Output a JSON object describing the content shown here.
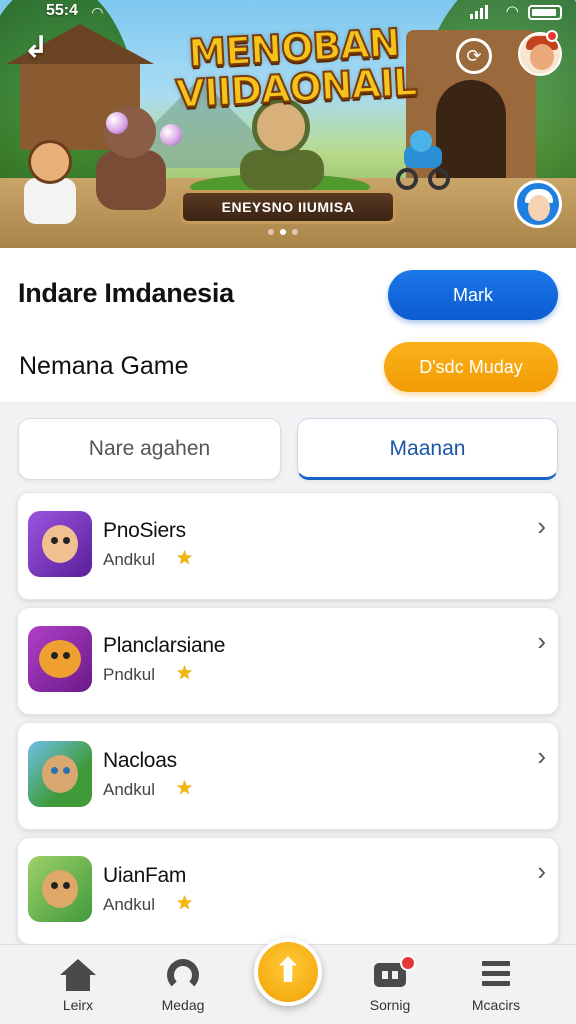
{
  "status_bar": {
    "time": "55:4"
  },
  "hero": {
    "title_line1": "MENOBAN",
    "title_line2": "VIIDAONAIL",
    "plaque": "ENEYSNO IIUMISA",
    "slide_count": 3,
    "active_slide": 2
  },
  "header": {
    "title": "Indare Imdanesia",
    "subtitle": "Nemana Game",
    "primary_button": "Mark",
    "secondary_button": "D'sdc Muday"
  },
  "tabs": [
    {
      "label": "Nare agahen",
      "active": false
    },
    {
      "label": "Maanan",
      "active": true
    }
  ],
  "games": [
    {
      "name": "PnoSiers",
      "developer": "Andkul",
      "icon": "purple-hair-character-icon",
      "icon_bg": "#7b3fbf"
    },
    {
      "name": "Planclarsiane",
      "developer": "Pndkul",
      "icon": "orange-face-character-icon",
      "icon_bg": "#8a2a9a"
    },
    {
      "name": "Nacloas",
      "developer": "Andkul",
      "icon": "goggles-warrior-character-icon",
      "icon_bg": "#3f9a3a"
    },
    {
      "name": "UianFam",
      "developer": "Andkul",
      "icon": "helmet-adventurer-character-icon",
      "icon_bg": "#4caa3a"
    }
  ],
  "bottom_nav": [
    {
      "label": "Leirx",
      "icon": "home-icon"
    },
    {
      "label": "Medag",
      "icon": "headphones-icon"
    },
    {
      "label": "Sornig",
      "icon": "messages-icon",
      "badge": true
    },
    {
      "label": "Mcacirs",
      "icon": "menu-icon"
    }
  ],
  "fab": {
    "icon": "arrow-up-icon"
  },
  "colors": {
    "primary": "#0b5bd0",
    "accent": "#f29b06",
    "tab_active": "#1a63c8",
    "badge": "#e53935"
  }
}
